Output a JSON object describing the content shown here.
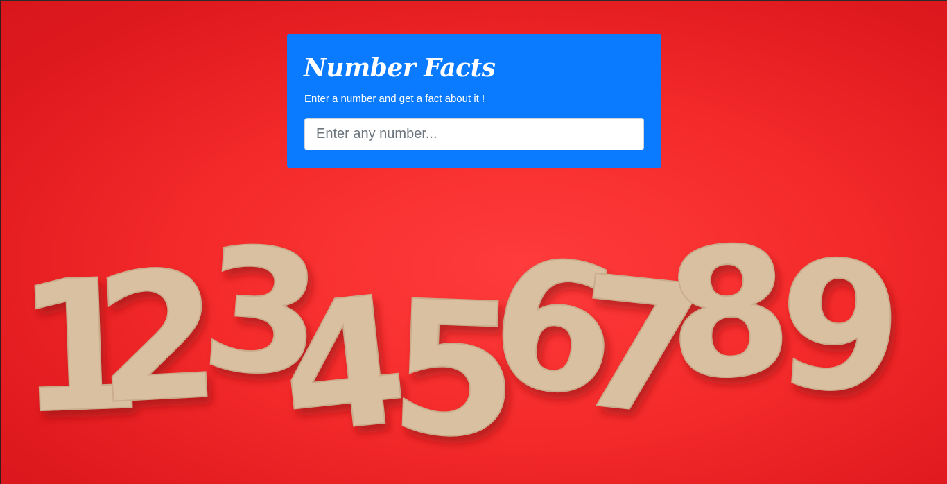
{
  "card": {
    "title": "Number Facts",
    "subtitle": "Enter a number and get a fact about it !"
  },
  "search": {
    "placeholder": "Enter any number...",
    "value": ""
  },
  "background": {
    "digits": [
      "1",
      "2",
      "3",
      "4",
      "5",
      "6",
      "7",
      "8",
      "9"
    ]
  },
  "colors": {
    "background": "#f42a2a",
    "card": "#0a7bff",
    "digits": "#d9bfa0"
  }
}
